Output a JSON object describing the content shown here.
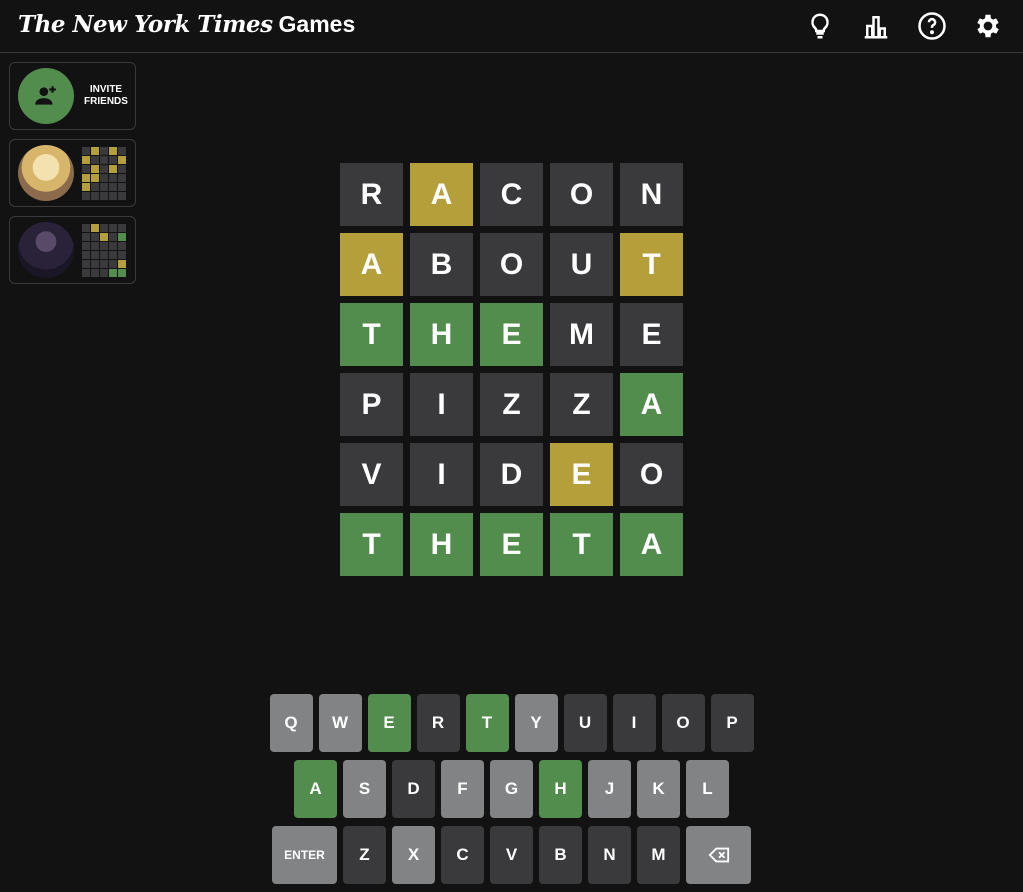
{
  "header": {
    "brand_nyt": "The New York Times",
    "brand_games": "Games",
    "icons": [
      "lightbulb-icon",
      "stats-icon",
      "help-icon",
      "settings-icon"
    ]
  },
  "colors": {
    "background": "#121213",
    "absent": "#3a3a3c",
    "present": "#b59f3b",
    "correct": "#538d4e",
    "key_default": "#818384",
    "key_absent": "#3a3a3c"
  },
  "sidebar": {
    "invite": {
      "label_line1": "INVITE",
      "label_line2": "FRIENDS"
    },
    "friends": [
      {
        "avatar": "anime-avatar-blonde",
        "grid": [
          [
            "absent",
            "present",
            "absent",
            "present",
            "absent"
          ],
          [
            "present",
            "absent",
            "absent",
            "absent",
            "present"
          ],
          [
            "absent",
            "present",
            "absent",
            "present",
            "absent"
          ],
          [
            "present",
            "present",
            "absent",
            "absent",
            "absent"
          ],
          [
            "present",
            "absent",
            "absent",
            "absent",
            "absent"
          ],
          [
            "absent",
            "absent",
            "absent",
            "absent",
            "absent"
          ]
        ]
      },
      {
        "avatar": "anime-avatar-dark",
        "grid": [
          [
            "absent",
            "present",
            "absent",
            "absent",
            "absent"
          ],
          [
            "absent",
            "absent",
            "present",
            "absent",
            "correct"
          ],
          [
            "absent",
            "absent",
            "absent",
            "absent",
            "absent"
          ],
          [
            "absent",
            "absent",
            "absent",
            "absent",
            "absent"
          ],
          [
            "absent",
            "absent",
            "absent",
            "absent",
            "present"
          ],
          [
            "absent",
            "absent",
            "absent",
            "correct",
            "correct"
          ]
        ]
      }
    ]
  },
  "board": {
    "rows": [
      {
        "letters": [
          "R",
          "A",
          "C",
          "O",
          "N"
        ],
        "states": [
          "absent",
          "present",
          "absent",
          "absent",
          "absent"
        ]
      },
      {
        "letters": [
          "A",
          "B",
          "O",
          "U",
          "T"
        ],
        "states": [
          "present",
          "absent",
          "absent",
          "absent",
          "present"
        ]
      },
      {
        "letters": [
          "T",
          "H",
          "E",
          "M",
          "E"
        ],
        "states": [
          "correct",
          "correct",
          "correct",
          "absent",
          "absent"
        ]
      },
      {
        "letters": [
          "P",
          "I",
          "Z",
          "Z",
          "A"
        ],
        "states": [
          "absent",
          "absent",
          "absent",
          "absent",
          "correct"
        ]
      },
      {
        "letters": [
          "V",
          "I",
          "D",
          "E",
          "O"
        ],
        "states": [
          "absent",
          "absent",
          "absent",
          "present",
          "absent"
        ]
      },
      {
        "letters": [
          "T",
          "H",
          "E",
          "T",
          "A"
        ],
        "states": [
          "correct",
          "correct",
          "correct",
          "correct",
          "correct"
        ]
      }
    ]
  },
  "keyboard": {
    "rows": [
      [
        {
          "label": "Q",
          "state": "default"
        },
        {
          "label": "W",
          "state": "default"
        },
        {
          "label": "E",
          "state": "correct"
        },
        {
          "label": "R",
          "state": "absent"
        },
        {
          "label": "T",
          "state": "correct"
        },
        {
          "label": "Y",
          "state": "default"
        },
        {
          "label": "U",
          "state": "absent"
        },
        {
          "label": "I",
          "state": "absent"
        },
        {
          "label": "O",
          "state": "absent"
        },
        {
          "label": "P",
          "state": "absent"
        }
      ],
      [
        {
          "label": "A",
          "state": "correct"
        },
        {
          "label": "S",
          "state": "default"
        },
        {
          "label": "D",
          "state": "absent"
        },
        {
          "label": "F",
          "state": "default"
        },
        {
          "label": "G",
          "state": "default"
        },
        {
          "label": "H",
          "state": "correct"
        },
        {
          "label": "J",
          "state": "default"
        },
        {
          "label": "K",
          "state": "default"
        },
        {
          "label": "L",
          "state": "default"
        }
      ],
      [
        {
          "label": "ENTER",
          "state": "default",
          "wide": true
        },
        {
          "label": "Z",
          "state": "absent"
        },
        {
          "label": "X",
          "state": "default"
        },
        {
          "label": "C",
          "state": "absent"
        },
        {
          "label": "V",
          "state": "absent"
        },
        {
          "label": "B",
          "state": "absent"
        },
        {
          "label": "N",
          "state": "absent"
        },
        {
          "label": "M",
          "state": "absent"
        },
        {
          "label": "",
          "state": "default",
          "wide": true,
          "icon": "backspace-icon"
        }
      ]
    ]
  }
}
